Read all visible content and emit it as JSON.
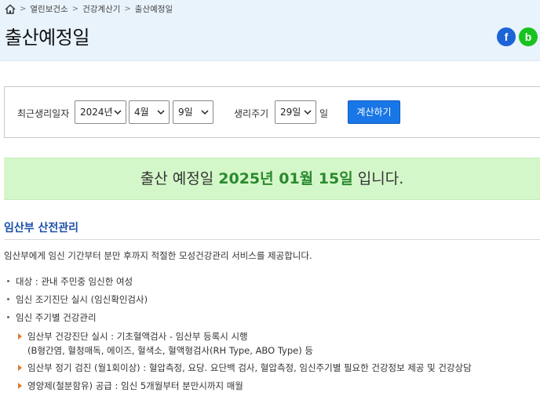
{
  "breadcrumb": {
    "home_icon": "home-icon",
    "items": [
      "열린보건소",
      "건강계산기",
      "출산예정일"
    ]
  },
  "header": {
    "title": "출산예정일",
    "share_facebook": "f",
    "share_blog": "b",
    "facebook_color": "#1d63d8",
    "blog_color": "#19c21e"
  },
  "form": {
    "last_period_label": "최근생리일자",
    "year": "2024년",
    "month": "4월",
    "day": "9일",
    "cycle_label": "생리주기",
    "cycle": "29일",
    "cycle_unit": "일",
    "calc_button": "계산하기"
  },
  "result": {
    "prefix": "출산 예정일",
    "date": "2025년 01월 15일",
    "suffix": "입니다."
  },
  "section": {
    "title": "임산부 산전관리",
    "description": "임산부에게 임신 기간부터 분만 후까지 적절한 모성건강관리 서비스를 제공합니다.",
    "items": [
      "대상 : 관내 주민중 임신한 여성",
      "임신 조기진단 실시 (임신확인검사)",
      "임신 주기별 건강관리"
    ],
    "subitems": [
      "임산부 건강진단 실시 : 기초혈액검사 - 임산부 등록시 시행",
      "(B형간염, 혈청매독, 에이즈, 혈색소, 혈액형검사(RH Type, ABO Type) 등",
      "임산부 정기 검진 (월1회이상) : 혈압측정, 요당. 요단백 검사, 혈압측정, 임신주기별 필요한 건강정보 제공 및 건강상담",
      "영양제(철분함유) 공급 : 임신 5개월부터 분만시까지 매월"
    ]
  }
}
